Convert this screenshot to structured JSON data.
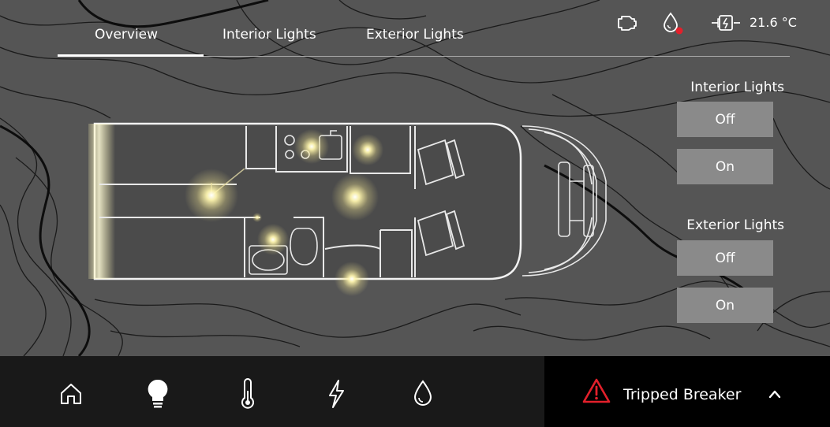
{
  "tabs": [
    {
      "label": "Overview",
      "active": true
    },
    {
      "label": "Interior Lights",
      "active": false
    },
    {
      "label": "Exterior Lights",
      "active": false
    }
  ],
  "status": {
    "temperature": "21.6 °C",
    "icons": [
      "engine-icon",
      "water-drop-alert-icon",
      "power-plug-icon"
    ],
    "alert_dot_color": "#e3202b"
  },
  "controls": {
    "interior": {
      "title": "Interior Lights",
      "off_label": "Off",
      "on_label": "On"
    },
    "exterior": {
      "title": "Exterior Lights",
      "off_label": "Off",
      "on_label": "On"
    }
  },
  "bottom_nav": {
    "items": [
      "home-icon",
      "light-bulb-icon",
      "thermometer-icon",
      "lightning-icon",
      "water-drop-icon"
    ],
    "active": "light-bulb-icon"
  },
  "alert": {
    "text": "Tripped Breaker",
    "icon": "warning-triangle-icon",
    "color": "#e3202b"
  },
  "colors": {
    "background": "#555555",
    "light_glow": "#fff6b0",
    "button": "#8a8a8a",
    "nav_bg": "#191919",
    "alert_bg": "#000000"
  }
}
